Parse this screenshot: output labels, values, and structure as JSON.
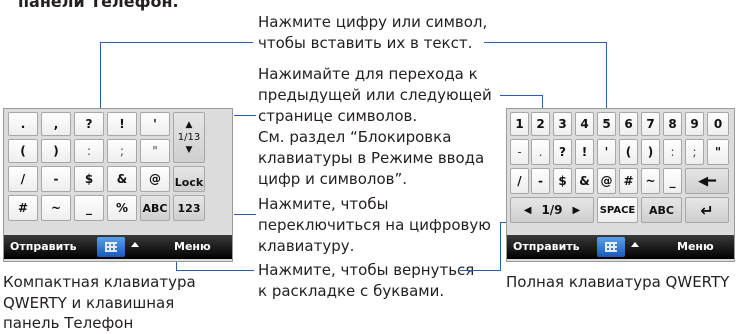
{
  "heading": "панели Телефон.",
  "callouts": {
    "insert_1": "Нажмите цифру или символ,",
    "insert_2": "чтобы вставить их в текст.",
    "page_1": "Нажимайте для перехода к",
    "page_2": "предыдущей или следующей",
    "page_3": "странице символов.",
    "page_4": "См. раздел “Блокировка",
    "page_5": "клавиатуры в Режиме ввода",
    "page_6": "цифр и символов”.",
    "numpad_1": "Нажмите, чтобы",
    "numpad_2": "переключиться на цифровую",
    "numpad_3": "клавиатуру.",
    "letters_1": "Нажмите, чтобы вернуться",
    "letters_2": "к раскладке с буквами."
  },
  "captions": {
    "compact_1": "Компактная клавиатура",
    "compact_2": "QWERTY и клавишная",
    "compact_3": "панель Телефон",
    "full": "Полная клавиатура QWERTY"
  },
  "compact_keyboard": {
    "rows": [
      [
        ".",
        ",",
        "?",
        "!",
        "'"
      ],
      [
        "(",
        ")",
        ":",
        ";",
        "\""
      ],
      [
        "/",
        "-",
        "$",
        "&",
        "@"
      ],
      [
        "#",
        "~",
        "_",
        "%",
        "ABC"
      ]
    ],
    "page": "1/13",
    "lock": "Lock",
    "numpad": "123",
    "send": "Отправить",
    "menu": "Меню"
  },
  "full_keyboard": {
    "row1": [
      "1",
      "2",
      "3",
      "4",
      "5",
      "6",
      "7",
      "8",
      "9",
      "0"
    ],
    "row2": [
      "-",
      ".",
      "?",
      "!",
      "'",
      "(",
      ")",
      ":",
      ";",
      "\""
    ],
    "row3": [
      "/",
      "-",
      "$",
      "&",
      "@",
      "#",
      "~",
      "_"
    ],
    "page": "1/9",
    "space": "SPACE",
    "abc": "ABC",
    "send": "Отправить",
    "menu": "Меню"
  },
  "icons": {
    "up": "▲",
    "down": "▼",
    "left": "◀",
    "right": "▶",
    "backspace": "◀━",
    "enter": "↵"
  }
}
